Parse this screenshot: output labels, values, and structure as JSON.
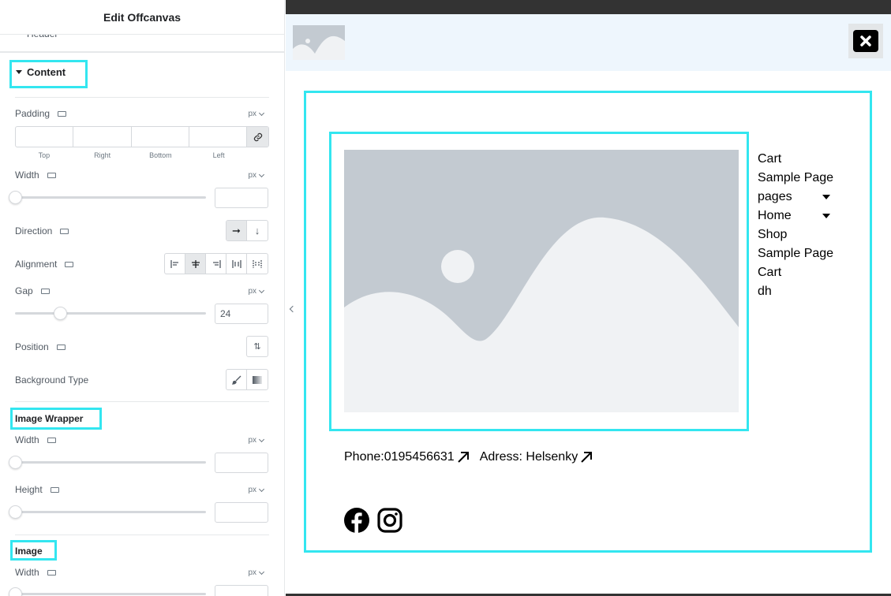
{
  "panel": {
    "title": "Edit Offcanvas",
    "cut_label": "Header",
    "content_section": "Content",
    "padding": {
      "label": "Padding",
      "unit": "px",
      "sides": [
        "Top",
        "Right",
        "Bottom",
        "Left"
      ]
    },
    "width": {
      "label": "Width",
      "unit": "px",
      "value": ""
    },
    "direction": {
      "label": "Direction"
    },
    "alignment": {
      "label": "Alignment"
    },
    "gap": {
      "label": "Gap",
      "unit": "px",
      "value": "24"
    },
    "position": {
      "label": "Position"
    },
    "background_type": {
      "label": "Background Type"
    },
    "image_wrapper": {
      "title": "Image Wrapper",
      "width": {
        "label": "Width",
        "unit": "px",
        "value": ""
      },
      "height": {
        "label": "Height",
        "unit": "px",
        "value": ""
      }
    },
    "image": {
      "title": "Image",
      "width": {
        "label": "Width",
        "unit": "px",
        "value": ""
      }
    }
  },
  "preview": {
    "menu": [
      {
        "label": "Cart",
        "dropdown": false
      },
      {
        "label": "Sample Page",
        "dropdown": false
      },
      {
        "label": "pages",
        "dropdown": true
      },
      {
        "label": "Home",
        "dropdown": true
      },
      {
        "label": "Shop",
        "dropdown": false
      },
      {
        "label": "Sample Page",
        "dropdown": false
      },
      {
        "label": "Cart",
        "dropdown": false
      },
      {
        "label": "dh",
        "dropdown": false
      }
    ],
    "contact": {
      "phone": "Phone:0195456631",
      "address": "Adress: Helsenky"
    },
    "social_icons": [
      "facebook-icon",
      "instagram-icon"
    ]
  },
  "colors": {
    "highlight": "#33e6f0",
    "placeholder_gray": "#c3cad1",
    "placeholder_light": "#f0f2f4",
    "header_bg": "#eef6fd"
  }
}
